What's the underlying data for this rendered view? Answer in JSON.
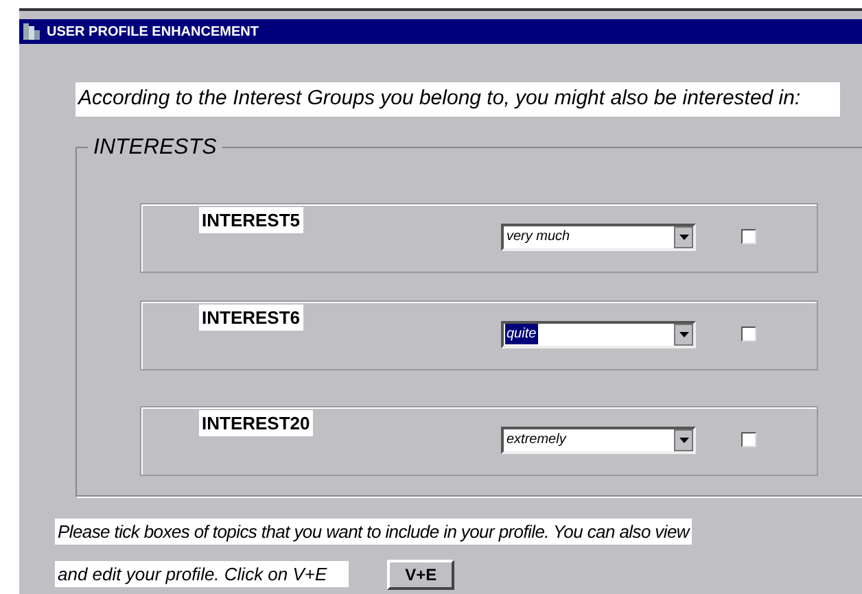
{
  "window": {
    "title": "USER PROFILE ENHANCEMENT"
  },
  "intro": "According to the Interest Groups you belong to, you might also be interested in:",
  "group": {
    "title": "INTERESTS",
    "rows": [
      {
        "label": "INTEREST5",
        "value": "very much",
        "focused": false,
        "checked": false
      },
      {
        "label": "INTEREST6",
        "value": "quite",
        "focused": true,
        "checked": false
      },
      {
        "label": "INTEREST20",
        "value": "extremely",
        "focused": false,
        "checked": false
      }
    ]
  },
  "instructions": [
    "Please tick boxes of topics that you want to include in your profile. You can also view",
    "and edit your profile. Click on V+E"
  ],
  "button": "V+E"
}
